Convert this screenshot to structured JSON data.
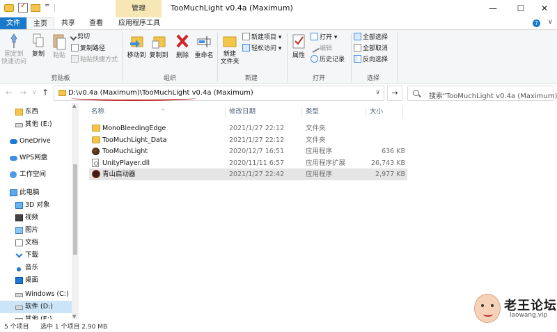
{
  "window": {
    "title": "TooMuchLight v0.4a (Maximum)",
    "context_tab_group": "管理",
    "min_glyph": "—",
    "max_glyph": "☐",
    "close_glyph": "✕",
    "qa_dropdown": "="
  },
  "tabs": {
    "file": "文件",
    "home": "主页",
    "share": "共享",
    "view": "查看",
    "app_tools": "应用程序工具",
    "expand": "∨",
    "help": "?"
  },
  "ribbon": {
    "clipboard": {
      "label": "剪贴板",
      "pin": "固定到\n快速访问",
      "copy": "复制",
      "paste": "粘贴",
      "cut": "剪切",
      "copy_path": "复制路径",
      "paste_shortcut": "粘贴快捷方式"
    },
    "organize": {
      "label": "组织",
      "move_to": "移动到",
      "copy_to": "复制到",
      "delete": "删除",
      "rename": "重命名"
    },
    "new": {
      "label": "新建",
      "new_folder": "新建\n文件夹",
      "new_item": "新建项目 ▾",
      "easy_access": "轻松访问 ▾"
    },
    "open": {
      "label": "打开",
      "properties": "属性",
      "open": "打开 ▾",
      "edit": "编辑",
      "history": "历史记录"
    },
    "select": {
      "label": "选择",
      "select_all": "全部选择",
      "select_none": "全部取消",
      "invert": "反向选择"
    }
  },
  "nav": {
    "back": "←",
    "forward": "→",
    "recent": "∨",
    "up": "↑",
    "refresh": "→"
  },
  "address": {
    "path": "D:\\v0.4a (Maximum)\\TooMuchLight v0.4a (Maximum)",
    "chevron": "∨"
  },
  "search": {
    "placeholder": "搜索\"TooMuchLight v0.4a (Maximum)\""
  },
  "sidebar": {
    "items": [
      {
        "label": "东西",
        "icon": "folder-icon"
      },
      {
        "label": "其他 (E:)",
        "icon": "drive-icon"
      },
      {
        "label": "OneDrive",
        "icon": "onedrive-icon"
      },
      {
        "label": "WPS网盘",
        "icon": "cloud-icon"
      },
      {
        "label": "工作空间",
        "icon": "workspace-icon"
      },
      {
        "label": "此电脑",
        "icon": "computer-icon"
      },
      {
        "label": "3D 对象",
        "icon": "3d-objects-icon"
      },
      {
        "label": "视频",
        "icon": "video-icon"
      },
      {
        "label": "图片",
        "icon": "pictures-icon"
      },
      {
        "label": "文档",
        "icon": "documents-icon"
      },
      {
        "label": "下载",
        "icon": "download-icon"
      },
      {
        "label": "音乐",
        "icon": "music-icon"
      },
      {
        "label": "桌面",
        "icon": "desktop-icon"
      },
      {
        "label": "Windows (C:)",
        "icon": "drive-icon"
      },
      {
        "label": "软件 (D:)",
        "icon": "drive-icon"
      },
      {
        "label": "其他 (E:)",
        "icon": "drive-icon"
      }
    ]
  },
  "file_list": {
    "columns": {
      "name": "名称",
      "modified": "修改日期",
      "type": "类型",
      "size": "大小"
    },
    "sort_glyph": "^",
    "rows": [
      {
        "name": "MonoBleedingEdge",
        "modified": "2021/1/27 22:12",
        "type": "文件夹",
        "size": "",
        "icon": "folder-icon"
      },
      {
        "name": "TooMuchLight_Data",
        "modified": "2021/1/27 22:12",
        "type": "文件夹",
        "size": "",
        "icon": "folder-icon"
      },
      {
        "name": "TooMuchLight",
        "modified": "2020/12/7 16:51",
        "type": "应用程序",
        "size": "636 KB",
        "icon": "application-icon"
      },
      {
        "name": "UnityPlayer.dll",
        "modified": "2020/11/11 6:57",
        "type": "应用程序扩展",
        "size": "26,743 KB",
        "icon": "dll-icon"
      },
      {
        "name": "青山启动器",
        "modified": "2021/1/27 22:42",
        "type": "应用程序",
        "size": "2,977 KB",
        "icon": "launcher-icon"
      }
    ]
  },
  "status": {
    "count": "5 个项目",
    "selected": "选中 1 个项目  2.90 MB"
  },
  "watermark": {
    "title": "老王论坛",
    "url": "laowang.vip"
  },
  "colors": {
    "accent": "#1979ca",
    "selection": "#cce4f7",
    "context_tab": "#f7e7b4",
    "annotation": "#c0282b"
  }
}
